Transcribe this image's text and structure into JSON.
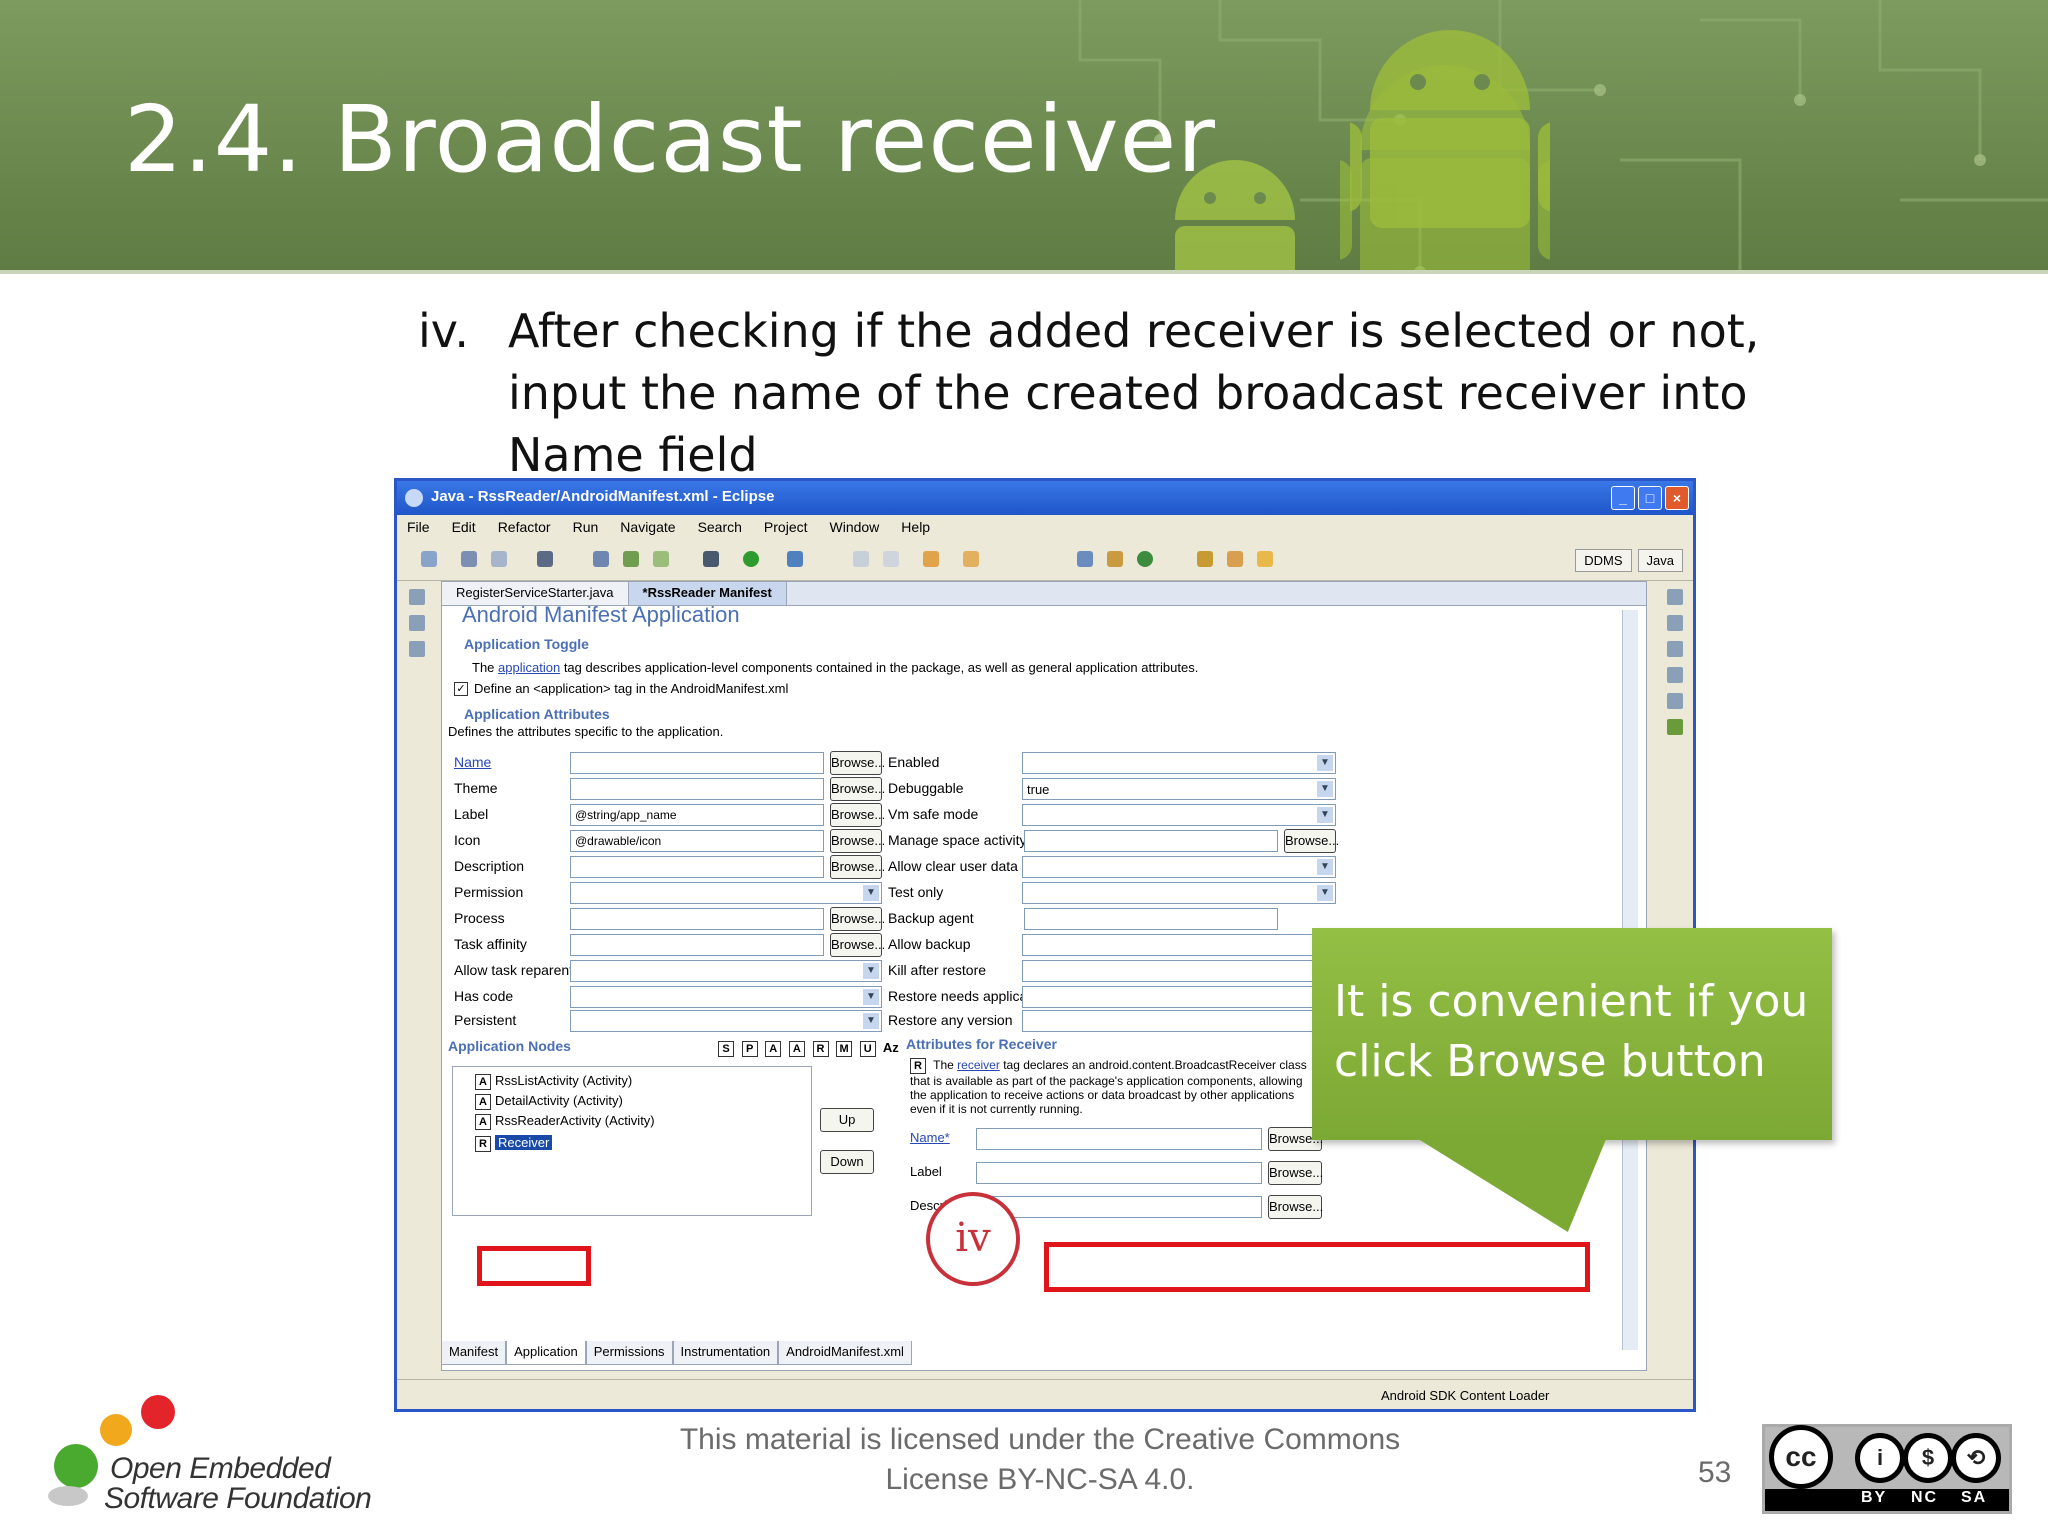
{
  "slide": {
    "title": "2.4. Broadcast receiver",
    "step_number": "iv.",
    "step_text": "After checking if the added receiver is selected or not, input the name of the created broadcast receiver into Name field",
    "callout_text": "It is convenient if you click Browse button",
    "circle_label": "iv",
    "footer_text": "This material is licensed under the Creative Commons License BY-NC-SA 4.0.",
    "page_number": "53",
    "logo_line1": "Open Embedded",
    "logo_line2": "Software Foundation",
    "cc_labels": [
      "BY",
      "NC",
      "SA"
    ]
  },
  "eclipse": {
    "window_title": "Java - RssReader/AndroidManifest.xml - Eclipse",
    "menu": [
      "File",
      "Edit",
      "Refactor",
      "Run",
      "Navigate",
      "Search",
      "Project",
      "Window",
      "Help"
    ],
    "perspectives": [
      "DDMS",
      "Java"
    ],
    "editor_tabs": [
      "RegisterServiceStarter.java",
      "*RssReader Manifest"
    ],
    "form_title": "Android Manifest Application",
    "toggle_section": "Application Toggle",
    "toggle_desc_pre": "The",
    "toggle_desc_link": "application",
    "toggle_desc_post": "tag describes application-level components contained in the package, as well as general application attributes.",
    "define_checkbox": "Define an <application> tag in the AndroidManifest.xml",
    "attr_section": "Application Attributes",
    "attr_desc": "Defines the attributes specific to the application.",
    "left_fields": [
      {
        "label": "Name",
        "value": ""
      },
      {
        "label": "Theme",
        "value": ""
      },
      {
        "label": "Label",
        "value": "@string/app_name"
      },
      {
        "label": "Icon",
        "value": "@drawable/icon"
      },
      {
        "label": "Description",
        "value": ""
      },
      {
        "label": "Permission",
        "value": ""
      },
      {
        "label": "Process",
        "value": ""
      },
      {
        "label": "Task affinity",
        "value": ""
      },
      {
        "label": "Allow task reparenting",
        "value": ""
      },
      {
        "label": "Has code",
        "value": ""
      },
      {
        "label": "Persistent",
        "value": ""
      }
    ],
    "right_fields": [
      {
        "label": "Enabled",
        "value": ""
      },
      {
        "label": "Debuggable",
        "value": "true"
      },
      {
        "label": "Vm safe mode",
        "value": ""
      },
      {
        "label": "Manage space activity",
        "value": ""
      },
      {
        "label": "Allow clear user data",
        "value": ""
      },
      {
        "label": "Test only",
        "value": ""
      },
      {
        "label": "Backup agent",
        "value": ""
      },
      {
        "label": "Allow backup",
        "value": ""
      },
      {
        "label": "Kill after restore",
        "value": ""
      },
      {
        "label": "Restore needs application",
        "value": ""
      },
      {
        "label": "Restore any version",
        "value": ""
      }
    ],
    "browse_label": "Browse...",
    "nodes_section": "Application Nodes",
    "node_filter_icons": [
      "S",
      "P",
      "A",
      "A",
      "R",
      "M",
      "U",
      "Az"
    ],
    "nodes": [
      {
        "icon": "A",
        "label": "RssListActivity (Activity)"
      },
      {
        "icon": "A",
        "label": "DetailActivity (Activity)"
      },
      {
        "icon": "A",
        "label": "RssReaderActivity (Activity)"
      },
      {
        "icon": "R",
        "label": "Receiver"
      }
    ],
    "up_button": "Up",
    "down_button": "Down",
    "receiver_section": "Attributes for Receiver",
    "receiver_desc_pre": "The",
    "receiver_desc_link": "receiver",
    "receiver_desc_post": "tag declares an android.content.BroadcastReceiver class that is available as part of the package's application components, allowing the application to receive actions or data broadcast by other applications even if it is not currently running.",
    "receiver_fields": [
      {
        "label": "Name*",
        "value": ""
      },
      {
        "label": "Label",
        "value": ""
      },
      {
        "label": "Description",
        "value": ""
      }
    ],
    "bottom_tabs": [
      "Manifest",
      "Application",
      "Permissions",
      "Instrumentation",
      "AndroidManifest.xml"
    ],
    "status_text": "Android SDK Content Loader"
  },
  "colors": {
    "banner": "#6c8a4f",
    "highlight_red": "#e0141b",
    "callout_green": "#8ab53e",
    "eclipse_title_blue": "#1f55c9"
  }
}
